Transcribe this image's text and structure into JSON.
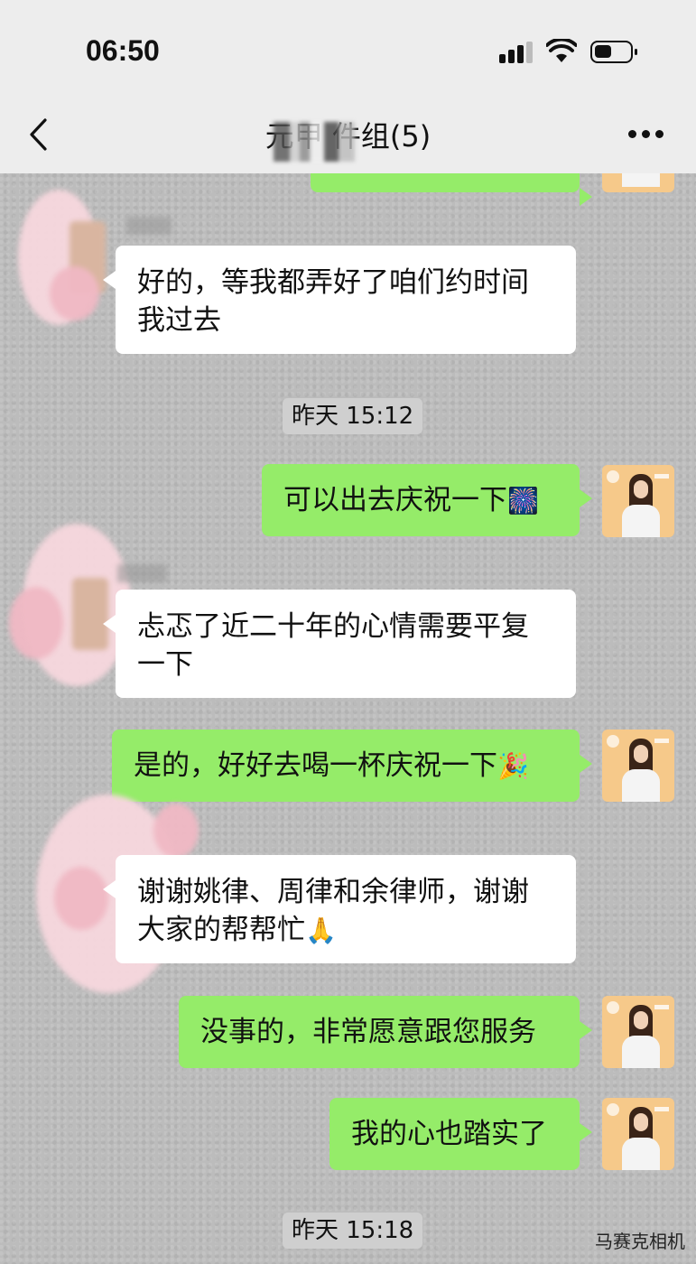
{
  "status_bar": {
    "time": "06:50"
  },
  "header": {
    "title": "元甲 件组(5)"
  },
  "messages": [
    {
      "id": "m0",
      "side": "out",
      "text": ""
    },
    {
      "id": "m1",
      "side": "in",
      "text": "好的，等我都弄好了咱们约时间我过去"
    },
    {
      "id": "t1",
      "type": "timestamp",
      "text": "昨天 15:12"
    },
    {
      "id": "m2",
      "side": "out",
      "text": "可以出去庆祝一下",
      "emoji": "🎆"
    },
    {
      "id": "m3",
      "side": "in",
      "text": "忐忑了近二十年的心情需要平复一下"
    },
    {
      "id": "m4",
      "side": "out",
      "text": "是的，好好去喝一杯庆祝一下",
      "emoji": "🎉"
    },
    {
      "id": "m5",
      "side": "in",
      "text": "谢谢姚律、周律和余律师，谢谢大家的帮帮忙",
      "emoji": "🙏"
    },
    {
      "id": "m6",
      "side": "out",
      "text": "没事的，非常愿意跟您服务"
    },
    {
      "id": "m7",
      "side": "out",
      "text": "我的心也踏实了"
    },
    {
      "id": "t2",
      "type": "timestamp",
      "text": "昨天 15:18"
    }
  ],
  "watermark": "马赛克相机"
}
